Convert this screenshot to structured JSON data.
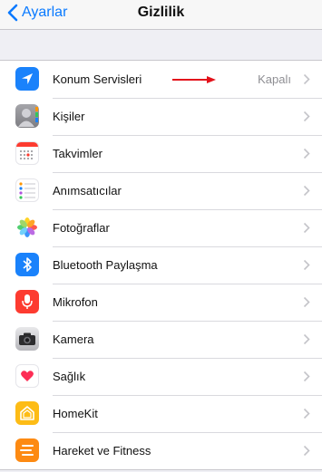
{
  "nav": {
    "back_label": "Ayarlar",
    "title": "Gizlilik"
  },
  "rows": [
    {
      "label": "Konum Servisleri",
      "value": "Kapalı",
      "icon": "location-arrow-icon",
      "color": "#1a82fb"
    },
    {
      "label": "Kişiler",
      "icon": "contacts-icon",
      "color": "#8e8e93"
    },
    {
      "label": "Takvimler",
      "icon": "calendar-icon",
      "color": "#ffffff"
    },
    {
      "label": "Anımsatıcılar",
      "icon": "reminders-icon",
      "color": "#ffffff"
    },
    {
      "label": "Fotoğraflar",
      "icon": "photos-icon",
      "color": "#ffffff"
    },
    {
      "label": "Bluetooth Paylaşma",
      "icon": "bluetooth-icon",
      "color": "#1a82fb"
    },
    {
      "label": "Mikrofon",
      "icon": "microphone-icon",
      "color": "#fd3b30"
    },
    {
      "label": "Kamera",
      "icon": "camera-icon",
      "color": "#3a3a3c"
    },
    {
      "label": "Sağlık",
      "icon": "health-heart-icon",
      "color": "#ffffff"
    },
    {
      "label": "HomeKit",
      "icon": "homekit-house-icon",
      "color": "#fdbc16"
    },
    {
      "label": "Hareket ve Fitness",
      "icon": "motion-fitness-icon",
      "color": "#fd8a12"
    }
  ],
  "annotation": {
    "icon": "red-arrow-icon",
    "color": "#e3121b"
  },
  "colors": {
    "accent": "#0a7aff",
    "background": "#efeff4"
  }
}
